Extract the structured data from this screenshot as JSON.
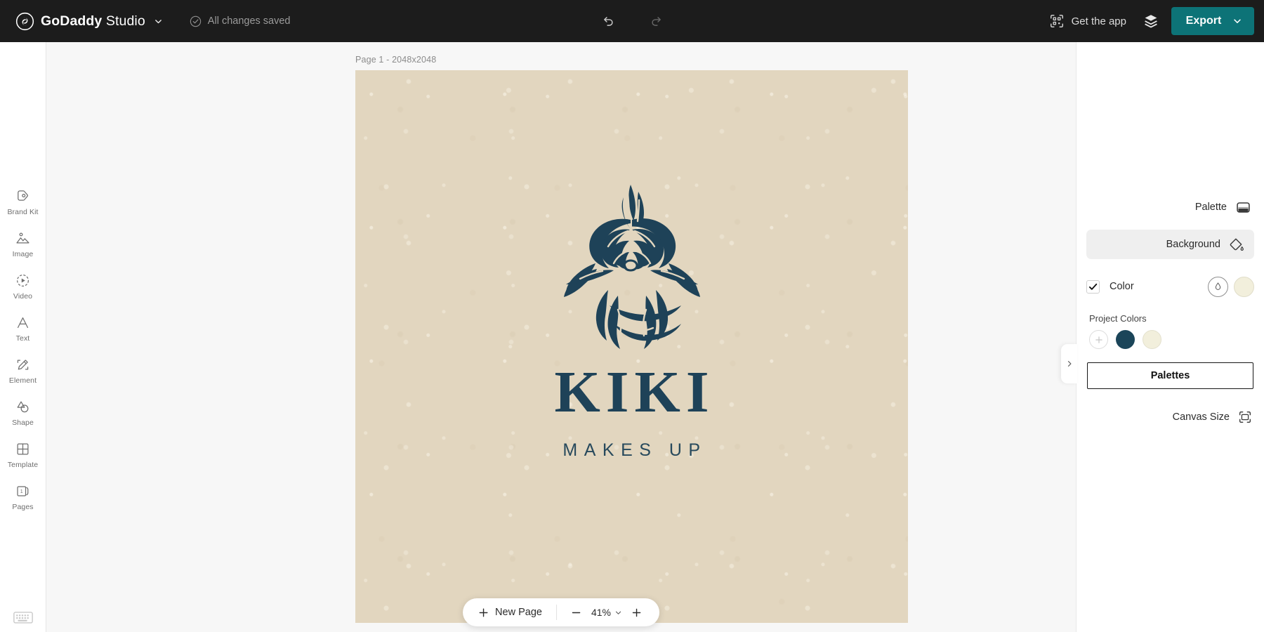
{
  "topbar": {
    "brand_bold": "GoDaddy",
    "brand_light": " Studio",
    "brand_caret_icon": "chevron-down-icon",
    "save_status": "All changes saved",
    "save_status_icon": "check-circle-icon",
    "undo_icon": "undo-arrow-icon",
    "redo_icon": "redo-arrow-icon",
    "get_app_label": "Get the app",
    "get_app_icon": "qr-code-icon",
    "layers_icon": "layers-stack-icon",
    "export_label": "Export",
    "export_caret_icon": "chevron-down-icon",
    "export_color": "#0d7377",
    "background_color": "#1c1c1c"
  },
  "left_rail": {
    "items": [
      {
        "label": "Brand Kit",
        "icon": "brand-kit-tag-icon"
      },
      {
        "label": "Image",
        "icon": "image-mountain-icon"
      },
      {
        "label": "Video",
        "icon": "video-play-circle-icon"
      },
      {
        "label": "Text",
        "icon": "text-letter-a-icon"
      },
      {
        "label": "Element",
        "icon": "element-pencil-icon"
      },
      {
        "label": "Shape",
        "icon": "shape-overlap-icon"
      },
      {
        "label": "Template",
        "icon": "template-grid-icon"
      },
      {
        "label": "Pages",
        "icon": "pages-card-icon"
      }
    ],
    "pages_badge": "1",
    "keyboard_icon": "keyboard-icon"
  },
  "workspace": {
    "page_label": "Page 1 - 2048x2048",
    "canvas_background": "#e2d6bf",
    "artwork": {
      "graphic_icon": "rose-linocut-illustration",
      "title": "KIKI",
      "subtitle": "MAKES UP",
      "ink_color": "#1e4258"
    }
  },
  "bottom_bar": {
    "new_page_label": "New Page",
    "new_page_icon": "plus-icon",
    "zoom_out_icon": "minus-icon",
    "zoom_in_icon": "plus-icon",
    "zoom_value": "41%",
    "zoom_caret_icon": "chevron-down-icon"
  },
  "right_panel": {
    "collapse_icon": "chevron-right-icon",
    "palette_label": "Palette",
    "palette_icon": "palette-swatch-icon",
    "background_label": "Background",
    "background_icon": "paint-bucket-icon",
    "color_label": "Color",
    "color_checked": true,
    "eyedropper_icon": "eyedropper-droplet-icon",
    "color_swatch": "#f2efdc",
    "project_colors_label": "Project Colors",
    "project_colors_add_icon": "plus-icon",
    "project_colors": [
      "#1b4559",
      "#f2efdc"
    ],
    "palettes_button_label": "Palettes",
    "canvas_size_label": "Canvas Size",
    "canvas_size_icon": "crop-frame-icon"
  }
}
